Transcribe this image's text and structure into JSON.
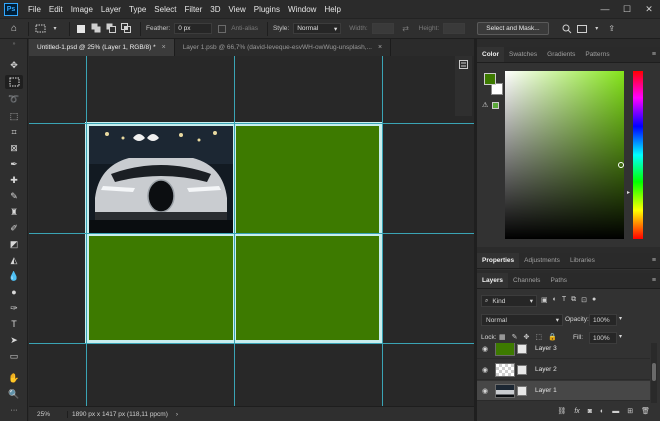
{
  "app": {
    "logo": "Ps"
  },
  "menu": [
    "File",
    "Edit",
    "Image",
    "Layer",
    "Type",
    "Select",
    "Filter",
    "3D",
    "View",
    "Plugins",
    "Window",
    "Help"
  ],
  "window_controls": [
    "—",
    "☐",
    "✕"
  ],
  "options_bar": {
    "feather_label": "Feather:",
    "feather_value": "0 px",
    "antialias_label": "Anti-alias",
    "style_label": "Style:",
    "style_value": "Normal",
    "width_label": "Width:",
    "height_label": "Height:",
    "select_mask_button": "Select and Mask..."
  },
  "tabs": [
    {
      "label": "Untitled-1.psd @ 25% (Layer 1, RGB/8) *",
      "close": "×"
    },
    {
      "label": "Layer 1.psb @ 66,7% (david-leveque-esvWH-owWug-unsplash,...",
      "close": "×"
    }
  ],
  "status": {
    "zoom": "25%",
    "doc_info": "1890 px x 1417 px (118,11 ppcm)",
    "arrow": "›"
  },
  "color_panel": {
    "tabs": [
      "Color",
      "Swatches",
      "Gradients",
      "Patterns"
    ],
    "active_tab": "Color",
    "foreground": "#3d7a00",
    "background": "#ffffff",
    "hue_color": "#84e41a"
  },
  "adjust_panel": {
    "tabs": [
      "Properties",
      "Adjustments",
      "Libraries"
    ],
    "active_tab": "Properties"
  },
  "layers_panel": {
    "tabs": [
      "Layers",
      "Channels",
      "Paths"
    ],
    "active_tab": "Layers",
    "kind_label": "Kind",
    "blend_mode": "Normal",
    "opacity_label": "Opacity:",
    "opacity_value": "100%",
    "lock_label": "Lock:",
    "fill_label": "Fill:",
    "fill_value": "100%",
    "layers": [
      {
        "name": "Layer 3",
        "thumb": "#3d7a00"
      },
      {
        "name": "Layer 2",
        "thumb": "checker"
      },
      {
        "name": "Layer 1",
        "thumb": "photo",
        "selected": true
      }
    ],
    "footer_icons": [
      "link-icon",
      "fx-icon",
      "mask-icon",
      "adjustment-icon",
      "group-icon",
      "new-layer-icon",
      "trash-icon"
    ],
    "fx_label": "fx"
  },
  "colors": {
    "accent_green": "#3d7a00",
    "guide": "#3aa4b5"
  }
}
